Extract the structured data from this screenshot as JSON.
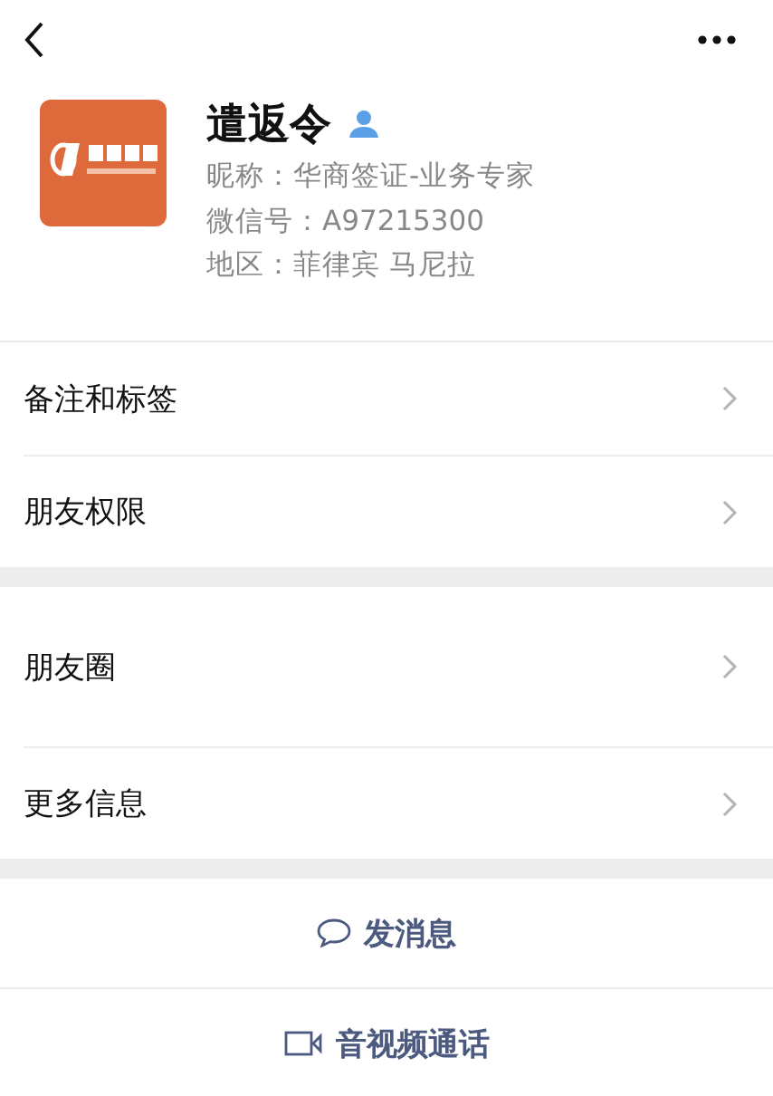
{
  "profile": {
    "name": "遣返令",
    "details": [
      "昵称：华商签证-业务专家",
      "微信号：A97215300",
      "地区：菲律宾 马尼拉"
    ]
  },
  "sections": [
    {
      "items": [
        {
          "label": "备注和标签"
        },
        {
          "label": "朋友权限"
        }
      ]
    },
    {
      "items": [
        {
          "label": "朋友圈"
        },
        {
          "label": "更多信息"
        }
      ]
    }
  ],
  "actions": [
    {
      "kind": "message",
      "label": "发消息"
    },
    {
      "kind": "video",
      "label": "音视频通话"
    }
  ]
}
